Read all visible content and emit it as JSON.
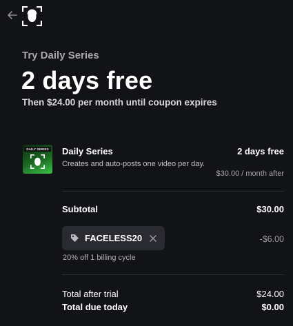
{
  "header": {
    "back_icon": "arrow-left-icon",
    "logo_icon": "face-frame-logo-icon"
  },
  "hero": {
    "eyebrow": "Try Daily Series",
    "title": "2 days free",
    "subtitle": "Then $24.00 per month until coupon expires"
  },
  "product": {
    "thumbnail_banner": "DAILY SERIES",
    "name": "Daily Series",
    "description": "Creates and auto-posts one video per day.",
    "price": "2 days free",
    "price_after": "$30.00 / month after"
  },
  "summary": {
    "subtotal_label": "Subtotal",
    "subtotal_value": "$30.00",
    "coupon_code": "FACELESS20",
    "coupon_icon": "tag-icon",
    "remove_icon": "close-icon",
    "discount_value": "-$6.00",
    "coupon_note": "20% off 1 billing cycle",
    "after_trial_label": "Total after trial",
    "after_trial_value": "$24.00",
    "due_today_label": "Total due today",
    "due_today_value": "$0.00"
  },
  "colors": {
    "background": "#121317",
    "coupon_chip": "#2a2b31",
    "thumbnail_green": "#39c548"
  }
}
